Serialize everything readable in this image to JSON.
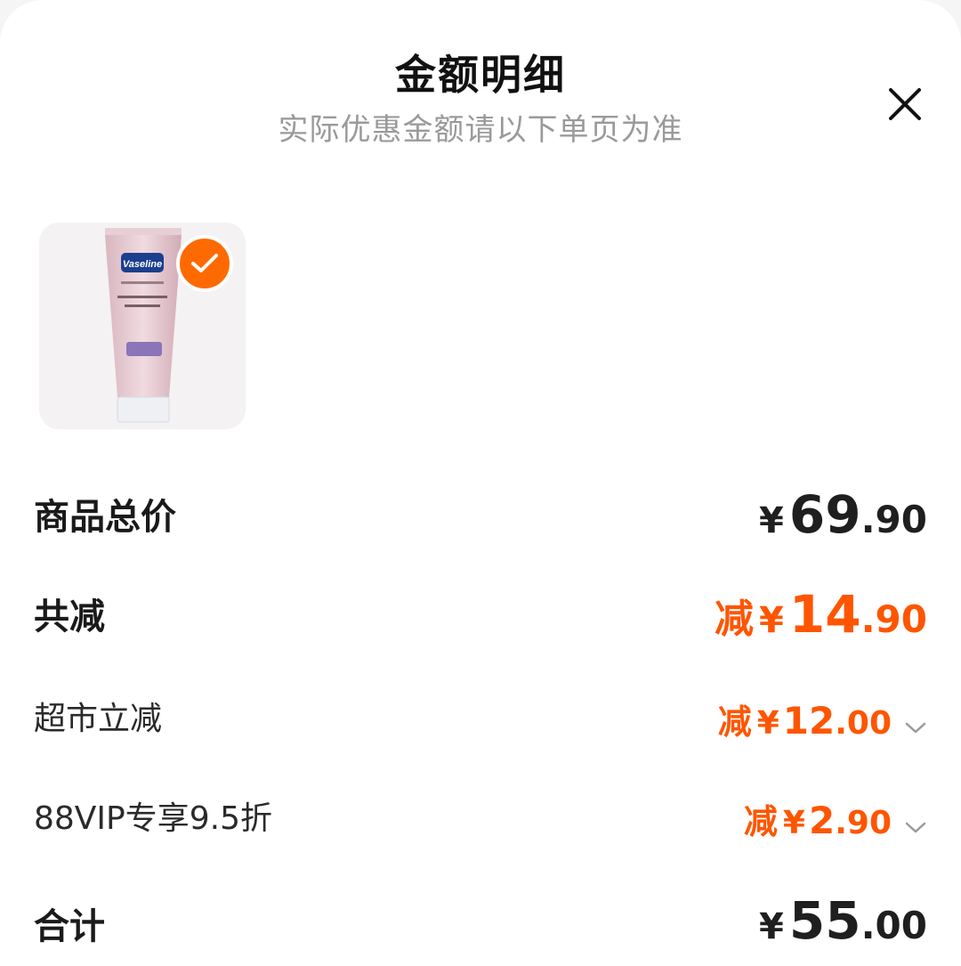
{
  "header": {
    "title": "金额明细",
    "subtitle": "实际优惠金额请以下单页为准"
  },
  "icons": {
    "close": "close-icon",
    "check": "checkmark-icon",
    "chevron": "chevron-down-icon"
  },
  "colors": {
    "accent": "#ff5500",
    "check_badge": "#ff6a00",
    "subtitle": "#9a9a9a"
  },
  "product": {
    "brand": "Vaseline",
    "selected": true
  },
  "rows": {
    "total_price": {
      "label": "商品总价",
      "currency": "¥",
      "integer": "69",
      "decimal": ".90"
    },
    "total_discount": {
      "label": "共减",
      "prefix": "减",
      "currency": "¥",
      "integer": "14",
      "decimal": ".90"
    },
    "supermarket": {
      "label": "超市立减",
      "prefix": "减",
      "currency": "¥",
      "integer": "12",
      "decimal": ".00"
    },
    "vip": {
      "label": "88VIP专享9.5折",
      "prefix": "减",
      "currency": "¥",
      "integer": "2",
      "decimal": ".90"
    },
    "sum": {
      "label": "合计",
      "currency": "¥",
      "integer": "55",
      "decimal": ".00"
    }
  }
}
